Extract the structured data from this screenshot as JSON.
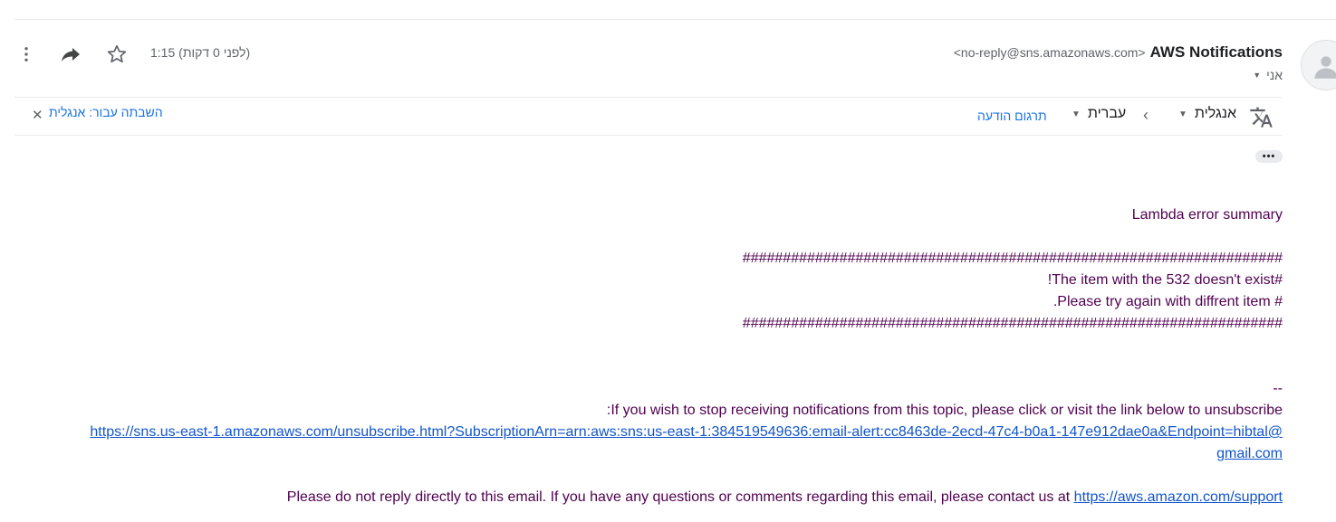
{
  "header": {
    "sender_name": "AWS Notifications",
    "sender_email": "<no-reply@sns.amazonaws.com>",
    "recipient": "אני",
    "timestamp": "1:15 (לפני 0 דקות)"
  },
  "icons": {
    "avatar": "person-icon",
    "star": "star-icon",
    "forward": "forward-icon",
    "more": "more-vert-icon",
    "translate": "translate-icon",
    "close": "close-icon",
    "ellipsis": "ellipsis-icon"
  },
  "translation_bar": {
    "source_language": "אנגלית",
    "target_language": "עברית",
    "translate_label": "תרגום הודעה",
    "disable_label": "השבתה עבור: אנגלית"
  },
  "message": {
    "title": "Lambda error  summary",
    "hash_line": "###################################################################",
    "line1": "#The item with the 532 doesn't exist!",
    "line2": "# Please try again with diffrent item.",
    "dashes": "--",
    "unsub_text": "If you wish to stop receiving notifications from this topic, please click or visit the link below to unsubscribe:",
    "unsub_link_part1": "https://sns.us-east-1.amazonaws.com/unsubscribe.html?SubscriptionArn=arn:aws:sns:us-east-1:384519549636:email-alert:cc8463de-2ecd-47c4-b0a1-147e912dae0a&Endpoint=hibtal@",
    "unsub_link_part2": "gmail.com",
    "contact_text": "Please do not reply directly to this email. If you have any questions or comments regarding this email, please contact us at",
    "contact_link": "https://aws.amazon.com/support"
  },
  "colors": {
    "body_text": "#500050",
    "link": "#1155cc",
    "accent": "#1a73e8"
  }
}
